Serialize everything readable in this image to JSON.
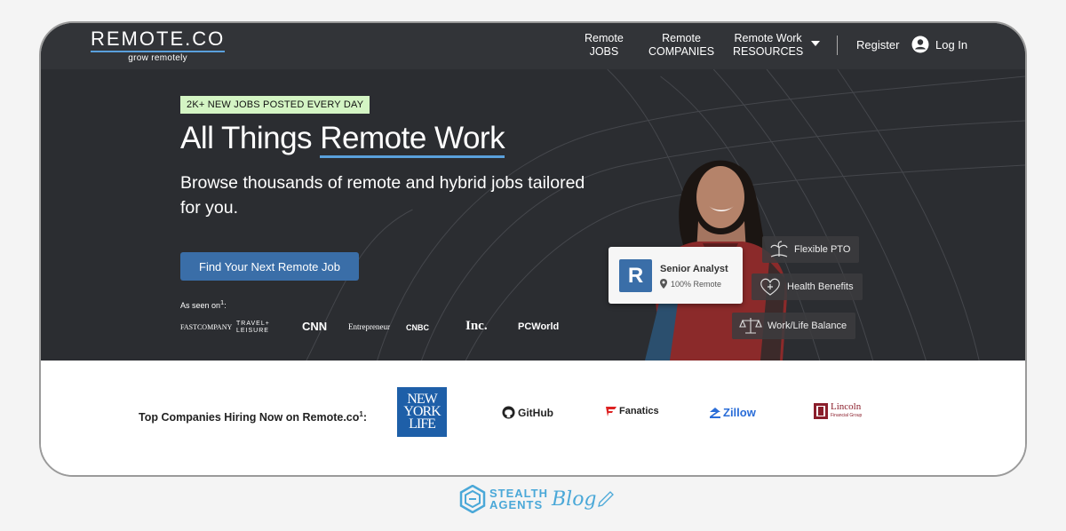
{
  "header": {
    "logo": "REMOTE.CO",
    "tagline": "grow remotely",
    "nav": [
      {
        "line1": "Remote",
        "line2": "JOBS"
      },
      {
        "line1": "Remote",
        "line2": "COMPANIES"
      },
      {
        "line1": "Remote Work",
        "line2": "RESOURCES"
      }
    ],
    "register": "Register",
    "login": "Log In"
  },
  "hero": {
    "badge": "2K+ NEW JOBS POSTED EVERY DAY",
    "title_prefix": "All Things ",
    "title_highlight": "Remote Work",
    "subtitle": "Browse thousands of remote and hybrid jobs tailored for you.",
    "cta": "Find Your Next Remote Job",
    "seen_on_label": "As seen on",
    "seen_on_sup": "1",
    "seen_on_suffix": ":",
    "press": [
      "FASTCOMPANY",
      "TRAVEL+ LEISURE",
      "CNN",
      "Entrepreneur",
      "CNBC",
      "Inc.",
      "PCWorld"
    ]
  },
  "job_card": {
    "logo_letter": "R",
    "title": "Senior Analyst",
    "location": "100% Remote"
  },
  "perks": [
    {
      "label": "Flexible PTO",
      "icon": "palm-tree-icon"
    },
    {
      "label": "Health Benefits",
      "icon": "heart-icon"
    },
    {
      "label": "Work/Life Balance",
      "icon": "scale-icon"
    }
  ],
  "companies": {
    "label": "Top Companies Hiring Now on Remote.co",
    "label_sup": "1",
    "label_suffix": ":",
    "logos": [
      "NEW YORK LIFE",
      "GitHub",
      "Fanatics",
      "Zillow",
      "Lincoln",
      "Financial Group"
    ]
  },
  "brand": {
    "line1": "STEALTH",
    "line2": "AGENTS",
    "script": "Blog"
  },
  "colors": {
    "hero_bg": "#2b2d31",
    "accent_blue": "#3a6ea8",
    "highlight_underline": "#5aa0dc",
    "badge_bg": "#d4f5c4",
    "brand_blue": "#4aa8d8"
  }
}
